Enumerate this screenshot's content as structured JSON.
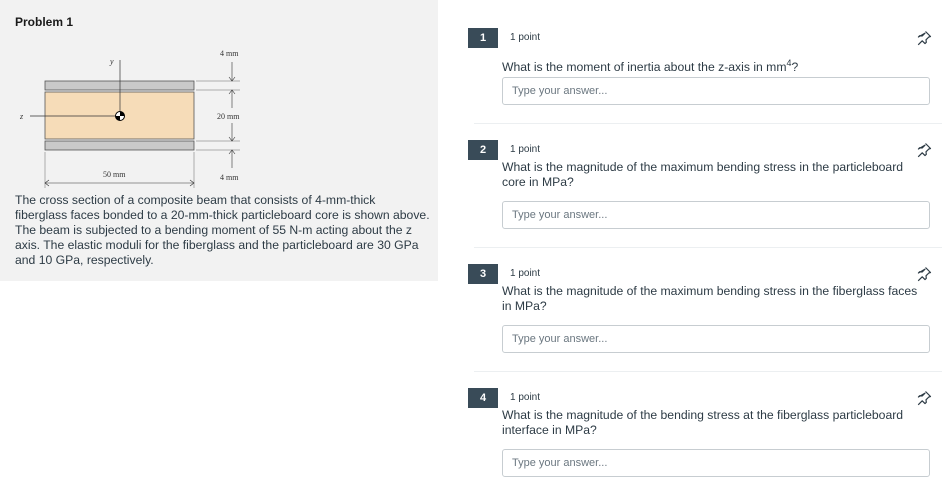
{
  "problem": {
    "title": "Problem 1",
    "description": "The cross section of a composite beam that consists of 4-mm-thick fiberglass faces bonded to a 20-mm-thick particleboard core is shown above. The beam is subjected to a bending moment of 55 N-m acting about the z axis. The elastic moduli for the fiberglass and the particleboard are 30 GPa and 10 GPa, respectively.",
    "figure": {
      "axis_y": "y",
      "axis_z": "z",
      "dim_top": "4 mm",
      "dim_core": "20 mm",
      "dim_bottom": "4 mm",
      "dim_width": "50 mm",
      "colors": {
        "core": "#f6dcb8",
        "face": "#c9c9c9"
      }
    }
  },
  "questions": [
    {
      "number": "1",
      "points": "1 point",
      "text_before": "What is the moment of inertia about the z-axis in mm",
      "superscript": "4",
      "text_after": "?",
      "placeholder": "Type your answer..."
    },
    {
      "number": "2",
      "points": "1 point",
      "text": "What is the magnitude of the maximum bending stress in the particleboard core in MPa?",
      "placeholder": "Type your answer..."
    },
    {
      "number": "3",
      "points": "1 point",
      "text": "What is the magnitude of the maximum bending stress in the fiberglass faces in MPa?",
      "placeholder": "Type your answer..."
    },
    {
      "number": "4",
      "points": "1 point",
      "text": "What is the magnitude of the bending stress at the fiberglass particleboard interface in MPa?",
      "placeholder": "Type your answer..."
    }
  ],
  "icons": {
    "pin": "pin-icon"
  },
  "colors": {
    "number_badge": "#394b58",
    "panel": "#f2f2f2",
    "text": "#2d3b45"
  }
}
